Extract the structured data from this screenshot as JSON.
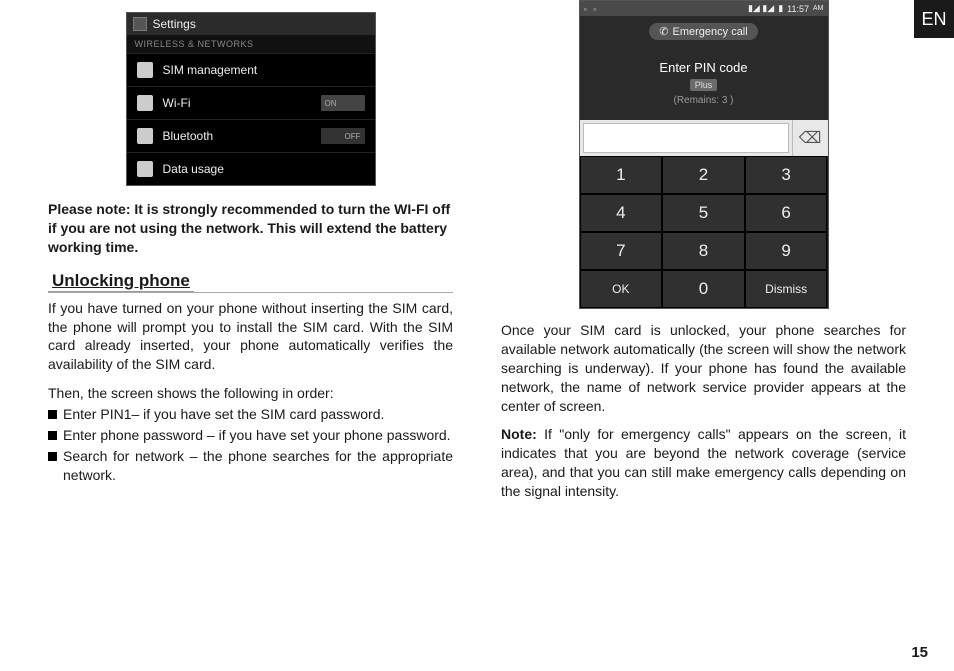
{
  "lang_tab": "EN",
  "page_number": "15",
  "left": {
    "settings_title": "Settings",
    "settings_category": "WIRELESS & NETWORKS",
    "settings_rows": {
      "sim": "SIM management",
      "wifi": "Wi-Fi",
      "wifi_toggle": "ON",
      "bt": "Bluetooth",
      "bt_toggle": "OFF",
      "data": "Data usage"
    },
    "strong_note": "Please note: It is strongly recommended to turn the WI-FI off if you are not using the network. This will extend the battery working time.",
    "section_title": "Unlocking phone",
    "para1": "If you have turned on your phone without inserting the SIM card, the phone will prompt you to install the SIM card. With the SIM card already inserted, your phone automatically verifies the availability of the SIM card.",
    "para2": "Then, the screen shows the following in order:",
    "bullets": {
      "b1": "Enter PIN1– if you have set the SIM card password.",
      "b2": "Enter phone password – if you have set your phone password.",
      "b3": "Search for network – the phone searches for the appropriate network."
    }
  },
  "right": {
    "statusbar_time": "11:57",
    "statusbar_ampm": "AM",
    "emergency_label": "Emergency call",
    "enter_pin": "Enter PIN code",
    "badge": "Plus",
    "remains": "(Remains: 3 )",
    "keys": {
      "k1": "1",
      "k2": "2",
      "k3": "3",
      "k4": "4",
      "k5": "5",
      "k6": "6",
      "k7": "7",
      "k8": "8",
      "k9": "9",
      "ok": "OK",
      "k0": "0",
      "dismiss": "Dismiss"
    },
    "para1": "Once your SIM card is unlocked, your phone searches for available network automatically (the screen will show the network searching is underway). If your phone has found the available network, the name of network service provider appears at the center of screen.",
    "note_label": "Note:",
    "note_body": " If \"only for emergency calls\" appears on the screen, it indicates that you are beyond the network coverage (service area), and that you can still make emergency calls depending on the signal intensity."
  }
}
